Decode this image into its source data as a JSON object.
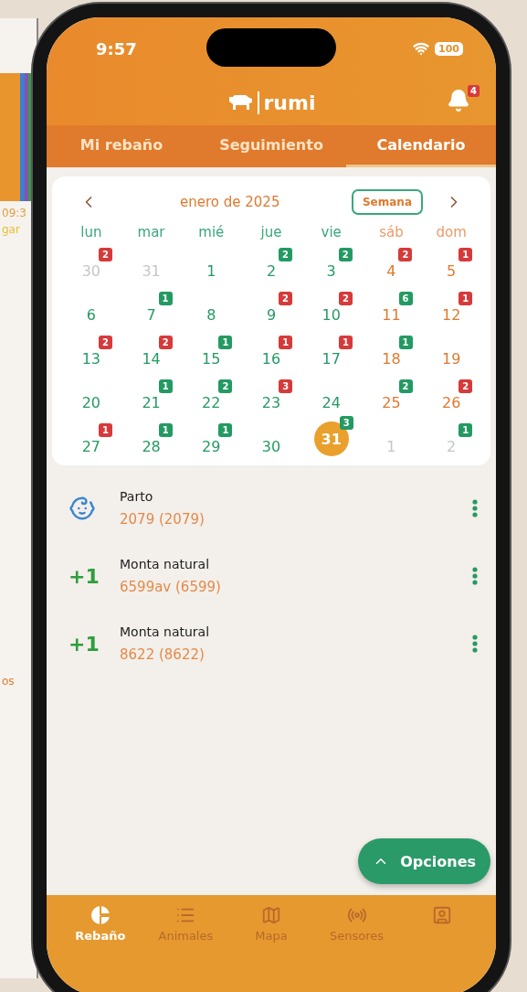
{
  "background_device": {
    "texts": [
      "09:3",
      "gar",
      "os"
    ]
  },
  "status_bar": {
    "time": "9:57",
    "battery": "100"
  },
  "header": {
    "logo": "rumi",
    "notifications": "4"
  },
  "tabs": [
    {
      "label": "Mi rebaño",
      "selected": false
    },
    {
      "label": "Seguimiento",
      "selected": false
    },
    {
      "label": "Calendario",
      "selected": true
    }
  ],
  "calendar": {
    "month": "enero de 2025",
    "view_button": "Semana",
    "weekdays": [
      {
        "label": "lun",
        "weekend": false
      },
      {
        "label": "mar",
        "weekend": false
      },
      {
        "label": "mié",
        "weekend": false
      },
      {
        "label": "jue",
        "weekend": false
      },
      {
        "label": "vie",
        "weekend": false
      },
      {
        "label": "sáb",
        "weekend": true
      },
      {
        "label": "dom",
        "weekend": true
      }
    ],
    "weeks": [
      [
        {
          "day": "30",
          "muted": true,
          "selected": false,
          "badge": "2",
          "color": "#d63a3a"
        },
        {
          "day": "31",
          "muted": true,
          "selected": false
        },
        {
          "day": "1",
          "muted": false,
          "selected": false
        },
        {
          "day": "2",
          "muted": false,
          "selected": false,
          "badge": "2",
          "color": "#249a63"
        },
        {
          "day": "3",
          "muted": false,
          "selected": false,
          "badge": "2",
          "color": "#249a63"
        },
        {
          "day": "4",
          "muted": false,
          "selected": false,
          "badge": "2",
          "color": "#d63a3a"
        },
        {
          "day": "5",
          "muted": false,
          "selected": false,
          "badge": "1",
          "color": "#d63a3a"
        }
      ],
      [
        {
          "day": "6",
          "muted": false,
          "selected": false
        },
        {
          "day": "7",
          "muted": false,
          "selected": false,
          "badge": "1",
          "color": "#249a63"
        },
        {
          "day": "8",
          "muted": false,
          "selected": false
        },
        {
          "day": "9",
          "muted": false,
          "selected": false,
          "badge": "2",
          "color": "#d63a3a"
        },
        {
          "day": "10",
          "muted": false,
          "selected": false,
          "badge": "2",
          "color": "#d63a3a"
        },
        {
          "day": "11",
          "muted": false,
          "selected": false,
          "badge": "6",
          "color": "#249a63"
        },
        {
          "day": "12",
          "muted": false,
          "selected": false,
          "badge": "1",
          "color": "#d63a3a"
        }
      ],
      [
        {
          "day": "13",
          "muted": false,
          "selected": false,
          "badge": "2",
          "color": "#d63a3a"
        },
        {
          "day": "14",
          "muted": false,
          "selected": false,
          "badge": "2",
          "color": "#d63a3a"
        },
        {
          "day": "15",
          "muted": false,
          "selected": false,
          "badge": "1",
          "color": "#249a63"
        },
        {
          "day": "16",
          "muted": false,
          "selected": false,
          "badge": "1",
          "color": "#d63a3a"
        },
        {
          "day": "17",
          "muted": false,
          "selected": false,
          "badge": "1",
          "color": "#d63a3a"
        },
        {
          "day": "18",
          "muted": false,
          "selected": false,
          "badge": "1",
          "color": "#249a63"
        },
        {
          "day": "19",
          "muted": false,
          "selected": false
        }
      ],
      [
        {
          "day": "20",
          "muted": false,
          "selected": false
        },
        {
          "day": "21",
          "muted": false,
          "selected": false,
          "badge": "1",
          "color": "#249a63"
        },
        {
          "day": "22",
          "muted": false,
          "selected": false,
          "badge": "2",
          "color": "#249a63"
        },
        {
          "day": "23",
          "muted": false,
          "selected": false,
          "badge": "3",
          "color": "#d63a3a"
        },
        {
          "day": "24",
          "muted": false,
          "selected": false
        },
        {
          "day": "25",
          "muted": false,
          "selected": false,
          "badge": "2",
          "color": "#249a63"
        },
        {
          "day": "26",
          "muted": false,
          "selected": false,
          "badge": "2",
          "color": "#d63a3a"
        }
      ],
      [
        {
          "day": "27",
          "muted": false,
          "selected": false,
          "badge": "1",
          "color": "#d63a3a"
        },
        {
          "day": "28",
          "muted": false,
          "selected": false,
          "badge": "1",
          "color": "#249a63"
        },
        {
          "day": "29",
          "muted": false,
          "selected": false,
          "badge": "1",
          "color": "#249a63"
        },
        {
          "day": "30",
          "muted": false,
          "selected": false
        },
        {
          "day": "31",
          "muted": false,
          "selected": true,
          "badge": "3",
          "color": "#249a63"
        },
        {
          "day": "1",
          "muted": true,
          "selected": false
        },
        {
          "day": "2",
          "muted": true,
          "selected": false,
          "badge": "1",
          "color": "#249a63"
        }
      ]
    ]
  },
  "events": [
    {
      "kind": "birth",
      "title": "Parto",
      "animal": "2079 (2079)"
    },
    {
      "kind": "count",
      "mark": "+1",
      "title": "Monta natural",
      "animal": "6599av (6599)"
    },
    {
      "kind": "count",
      "mark": "+1",
      "title": "Monta natural",
      "animal": "8622 (8622)"
    }
  ],
  "options_button": "Opciones",
  "bottom_nav": [
    {
      "label": "Rebaño",
      "selected": true
    },
    {
      "label": "Animales",
      "selected": false
    },
    {
      "label": "Mapa",
      "selected": false
    },
    {
      "label": "Sensores",
      "selected": false
    },
    {
      "selected": false
    }
  ]
}
